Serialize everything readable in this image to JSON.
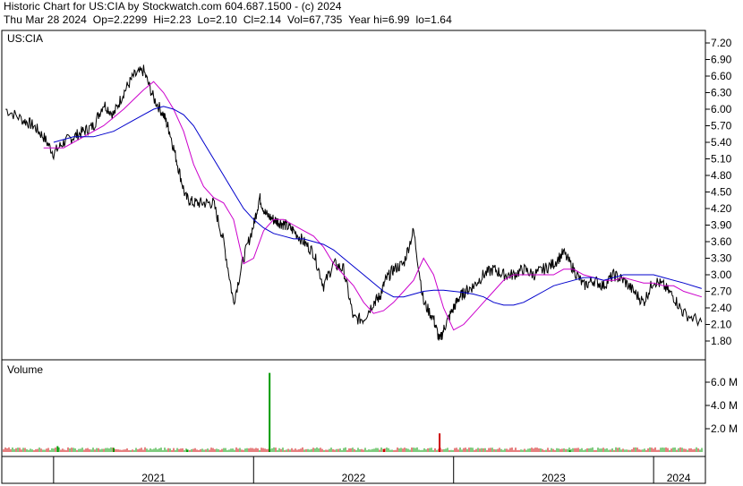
{
  "header": {
    "line1": "Historic Chart for US:CIA by Stockwatch.com 604.687.1500 - (c) 2024",
    "line2": "Thu Mar 28 2024  Op=2.2299  Hi=2.23  Lo=2.10  Cl=2.14  Vol=67,735  Year hi=6.99  lo=1.64"
  },
  "colors": {
    "price": "#000000",
    "ma_short": "#cc00cc",
    "ma_long": "#0000cc",
    "vol_up": "#009900",
    "vol_down": "#cc0000"
  },
  "chart_data": [
    {
      "type": "line",
      "title": "US:CIA",
      "ylim": [
        1.5,
        7.35
      ],
      "y_ticks": [
        "7.20",
        "6.90",
        "6.60",
        "6.30",
        "6.00",
        "5.70",
        "5.40",
        "5.10",
        "4.80",
        "4.50",
        "4.20",
        "3.90",
        "3.60",
        "3.30",
        "3.00",
        "2.70",
        "2.40",
        "2.10",
        "1.80"
      ],
      "x_ticks": [
        "2021",
        "2022",
        "2023",
        "2024"
      ],
      "xlim": [
        2020.75,
        2024.25
      ],
      "series": [
        {
          "role": "price",
          "x": [
            2020.76,
            2020.85,
            2020.9,
            2020.95,
            2021.0,
            2021.05,
            2021.1,
            2021.15,
            2021.2,
            2021.25,
            2021.3,
            2021.35,
            2021.4,
            2021.45,
            2021.5,
            2021.55,
            2021.58,
            2021.62,
            2021.66,
            2021.7,
            2021.75,
            2021.8,
            2021.85,
            2021.9,
            2021.95,
            2022.0,
            2022.03,
            2022.06,
            2022.1,
            2022.13,
            2022.16,
            2022.2,
            2022.25,
            2022.3,
            2022.35,
            2022.4,
            2022.45,
            2022.5,
            2022.55,
            2022.6,
            2022.63,
            2022.66,
            2022.7,
            2022.75,
            2022.8,
            2022.85,
            2022.9,
            2022.93,
            2022.96,
            2023.0,
            2023.03,
            2023.06,
            2023.1,
            2023.15,
            2023.2,
            2023.25,
            2023.3,
            2023.35,
            2023.4,
            2023.45,
            2023.5,
            2023.55,
            2023.6,
            2023.65,
            2023.7,
            2023.75,
            2023.8,
            2023.85,
            2023.9,
            2023.95,
            2024.0,
            2024.05,
            2024.1,
            2024.15,
            2024.24
          ],
          "values": [
            6.0,
            5.8,
            5.7,
            5.5,
            5.2,
            5.4,
            5.5,
            5.6,
            5.7,
            6.1,
            5.9,
            6.3,
            6.6,
            6.7,
            6.2,
            5.9,
            5.6,
            5.0,
            4.4,
            4.3,
            4.3,
            4.3,
            3.6,
            2.5,
            3.3,
            3.9,
            4.4,
            4.1,
            4.0,
            3.95,
            3.9,
            3.8,
            3.6,
            3.4,
            2.8,
            3.2,
            3.1,
            2.2,
            2.2,
            2.5,
            2.6,
            2.9,
            3.1,
            3.2,
            3.8,
            2.5,
            2.2,
            1.8,
            2.1,
            2.4,
            2.6,
            2.7,
            2.8,
            3.0,
            3.1,
            3.0,
            3.0,
            3.1,
            3.0,
            3.1,
            3.2,
            3.4,
            3.1,
            2.8,
            2.9,
            2.8,
            3.0,
            2.9,
            2.7,
            2.5,
            2.9,
            2.8,
            2.6,
            2.3,
            2.14
          ]
        },
        {
          "role": "ma_short",
          "x": [
            2020.95,
            2021.05,
            2021.15,
            2021.25,
            2021.35,
            2021.45,
            2021.5,
            2021.55,
            2021.6,
            2021.65,
            2021.7,
            2021.75,
            2021.8,
            2021.85,
            2021.9,
            2021.95,
            2022.0,
            2022.05,
            2022.1,
            2022.15,
            2022.2,
            2022.25,
            2022.3,
            2022.35,
            2022.4,
            2022.45,
            2022.5,
            2022.55,
            2022.6,
            2022.65,
            2022.7,
            2022.75,
            2022.8,
            2022.85,
            2022.9,
            2022.95,
            2023.0,
            2023.05,
            2023.1,
            2023.15,
            2023.2,
            2023.25,
            2023.3,
            2023.35,
            2023.4,
            2023.45,
            2023.5,
            2023.55,
            2023.6,
            2023.65,
            2023.7,
            2023.75,
            2023.8,
            2023.85,
            2023.9,
            2023.95,
            2024.0,
            2024.05,
            2024.1,
            2024.15,
            2024.24
          ],
          "values": [
            5.3,
            5.3,
            5.5,
            5.7,
            6.0,
            6.35,
            6.5,
            6.3,
            6.0,
            5.6,
            5.0,
            4.6,
            4.4,
            4.3,
            4.0,
            3.2,
            3.3,
            3.8,
            4.0,
            4.0,
            3.9,
            3.8,
            3.7,
            3.5,
            3.2,
            3.0,
            2.8,
            2.5,
            2.3,
            2.35,
            2.5,
            2.7,
            2.9,
            3.3,
            3.0,
            2.4,
            2.0,
            2.1,
            2.3,
            2.5,
            2.7,
            2.9,
            3.0,
            3.0,
            3.0,
            3.0,
            3.0,
            3.1,
            3.1,
            3.0,
            2.95,
            2.9,
            2.9,
            2.95,
            2.9,
            2.85,
            2.85,
            2.8,
            2.8,
            2.7,
            2.6
          ]
        },
        {
          "role": "ma_long",
          "x": [
            2021.0,
            2021.1,
            2021.2,
            2021.3,
            2021.4,
            2021.5,
            2021.55,
            2021.6,
            2021.65,
            2021.7,
            2021.75,
            2021.8,
            2021.85,
            2021.9,
            2021.95,
            2022.0,
            2022.05,
            2022.1,
            2022.15,
            2022.2,
            2022.25,
            2022.3,
            2022.35,
            2022.4,
            2022.45,
            2022.5,
            2022.55,
            2022.6,
            2022.65,
            2022.7,
            2022.75,
            2022.8,
            2022.85,
            2022.9,
            2022.95,
            2023.0,
            2023.05,
            2023.1,
            2023.15,
            2023.2,
            2023.25,
            2023.3,
            2023.35,
            2023.4,
            2023.45,
            2023.5,
            2023.55,
            2023.6,
            2023.65,
            2023.7,
            2023.75,
            2023.8,
            2023.85,
            2023.9,
            2023.95,
            2024.0,
            2024.05,
            2024.1,
            2024.15,
            2024.24
          ],
          "values": [
            5.4,
            5.5,
            5.5,
            5.6,
            5.8,
            6.0,
            6.05,
            6.0,
            5.9,
            5.7,
            5.4,
            5.1,
            4.8,
            4.5,
            4.2,
            4.0,
            3.85,
            3.75,
            3.7,
            3.65,
            3.65,
            3.6,
            3.55,
            3.45,
            3.3,
            3.15,
            3.0,
            2.85,
            2.7,
            2.6,
            2.6,
            2.65,
            2.7,
            2.72,
            2.72,
            2.7,
            2.68,
            2.65,
            2.6,
            2.5,
            2.45,
            2.45,
            2.5,
            2.6,
            2.7,
            2.8,
            2.85,
            2.9,
            2.95,
            2.95,
            2.9,
            2.95,
            3.0,
            3.0,
            3.0,
            3.0,
            2.95,
            2.9,
            2.85,
            2.75
          ]
        }
      ]
    },
    {
      "type": "bar",
      "title": "Volume",
      "y_ticks": [
        "6.0 M",
        "4.0 M",
        "2.0 M"
      ],
      "ylim": [
        0,
        7.5
      ],
      "spikes": [
        {
          "x": 2021.3,
          "value": 0.35,
          "color_role": "vol_up"
        },
        {
          "x": 2021.02,
          "value": 0.5,
          "color_role": "vol_up"
        },
        {
          "x": 2021.67,
          "value": 0.2,
          "color_role": "vol_up"
        },
        {
          "x": 2022.08,
          "value": 6.8,
          "color_role": "vol_up"
        },
        {
          "x": 2022.65,
          "value": 0.25,
          "color_role": "vol_down"
        },
        {
          "x": 2022.93,
          "value": 1.6,
          "color_role": "vol_down"
        },
        {
          "x": 2023.58,
          "value": 0.15,
          "color_role": "vol_up"
        }
      ]
    }
  ]
}
